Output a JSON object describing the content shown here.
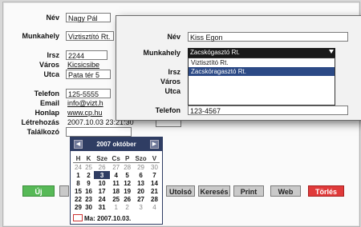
{
  "main_form": {
    "name_label": "Név",
    "name_value": "Nagy Pál",
    "workplace_label": "Munkahely",
    "workplace_value": "Viztisztító Rt.",
    "zip_label": "Irsz",
    "zip_value": "2244",
    "city_label": "Város",
    "city_value": "Kicsicsibe",
    "street_label": "Utca",
    "street_value": "Pata tér 5",
    "phone_label": "Telefon",
    "phone_value": "125-5555",
    "email_label": "Email",
    "email_value": "info@vizt.h",
    "homepage_label": "Honlap",
    "homepage_value": "www.cp.hu",
    "created_label": "Létrehozás",
    "created_value": "2007.10.03 23:21:30",
    "meeting_label": "Találkozó"
  },
  "popup": {
    "name_label": "Név",
    "name_value": "Kiss Egon",
    "workplace_label": "Munkahely",
    "workplace_selected": "Zacskógasztó Rt.",
    "options": [
      "Viztisztító Rt.",
      "Zacskóragasztó Rt."
    ],
    "zip_label": "Irsz",
    "city_label": "Város",
    "street_label": "Utca",
    "phone_label": "Telefon",
    "phone_value": "123-4567"
  },
  "calendar": {
    "year": "2007",
    "month": "október",
    "weekdays": [
      "H",
      "K",
      "Sze",
      "Cs",
      "P",
      "Szo",
      "V"
    ],
    "weeks": [
      [
        "24",
        "25",
        "26",
        "27",
        "28",
        "29",
        "30"
      ],
      [
        "1",
        "2",
        "3",
        "4",
        "5",
        "6",
        "7"
      ],
      [
        "8",
        "9",
        "10",
        "11",
        "12",
        "13",
        "14"
      ],
      [
        "15",
        "16",
        "17",
        "18",
        "19",
        "20",
        "21"
      ],
      [
        "22",
        "23",
        "24",
        "25",
        "26",
        "27",
        "28"
      ],
      [
        "29",
        "30",
        "31",
        "1",
        "2",
        "3",
        "4"
      ]
    ],
    "today_label": "Ma: 2007.10.03.",
    "prev_symbol": "◀",
    "next_symbol": "▶"
  },
  "buttons": {
    "new": "Új",
    "last": "Utolsó",
    "search": "Keresés",
    "print": "Print",
    "web": "Web",
    "delete": "Törlés"
  },
  "colors": {
    "new_button": "#57b957",
    "delete_button": "#e03a3a",
    "calendar_header": "#2f3d63"
  }
}
